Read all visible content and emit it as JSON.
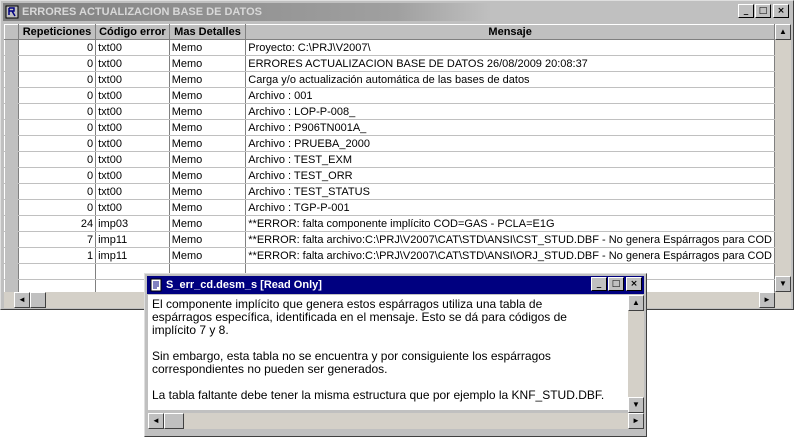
{
  "main_window": {
    "title": "ERRORES ACTUALIZACION BASE DE DATOS",
    "controls": {
      "minimize": "_",
      "maximize": "□",
      "close": "×"
    }
  },
  "grid": {
    "columns": [
      "Repeticiones",
      "Código error",
      "Mas Detalles",
      "Mensaje"
    ],
    "rows": [
      {
        "rep": "0",
        "code": "txt00",
        "detail": "Memo",
        "msg": "Proyecto: C:\\PRJ\\V2007\\"
      },
      {
        "rep": "0",
        "code": "txt00",
        "detail": "Memo",
        "msg": "ERRORES ACTUALIZACION BASE DE DATOS      26/08/2009      20:08:37"
      },
      {
        "rep": "0",
        "code": "txt00",
        "detail": "Memo",
        "msg": "Carga y/o actualización automática de las bases de datos"
      },
      {
        "rep": "0",
        "code": "txt00",
        "detail": "Memo",
        "msg": "Archivo : 001"
      },
      {
        "rep": "0",
        "code": "txt00",
        "detail": "Memo",
        "msg": "Archivo : LOP-P-008_"
      },
      {
        "rep": "0",
        "code": "txt00",
        "detail": "Memo",
        "msg": "Archivo : P906TN001A_"
      },
      {
        "rep": "0",
        "code": "txt00",
        "detail": "Memo",
        "msg": "Archivo : PRUEBA_2000"
      },
      {
        "rep": "0",
        "code": "txt00",
        "detail": "Memo",
        "msg": "Archivo : TEST_EXM"
      },
      {
        "rep": "0",
        "code": "txt00",
        "detail": "Memo",
        "msg": "Archivo : TEST_ORR"
      },
      {
        "rep": "0",
        "code": "txt00",
        "detail": "Memo",
        "msg": "Archivo : TEST_STATUS"
      },
      {
        "rep": "0",
        "code": "txt00",
        "detail": "Memo",
        "msg": "Archivo : TGP-P-001"
      },
      {
        "rep": "24",
        "code": "imp03",
        "detail": "Memo",
        "msg": "**ERROR: falta componente implícito COD=GAS    - PCLA=E1G"
      },
      {
        "rep": "7",
        "code": "imp11",
        "detail": "Memo",
        "msg": "**ERROR: falta archivo:C:\\PRJ\\V2007\\CAT\\STD\\ANSI\\CST_STUD.DBF - No genera Espárragos para COD"
      },
      {
        "rep": "1",
        "code": "imp11",
        "detail": "Memo",
        "msg": "**ERROR: falta archivo:C:\\PRJ\\V2007\\CAT\\STD\\ANSI\\ORJ_STUD.DBF - No genera Espárragos para COD"
      }
    ]
  },
  "memo_window": {
    "title": "S_err_cd.desm_s [Read Only]",
    "controls": {
      "minimize": "_",
      "maximize": "□",
      "close": "×"
    },
    "lines": [
      "El componente implícito que genera estos espárragos utiliza una tabla de",
      "espárragos específica, identificada en el mensaje. Esto se dá para códigos de",
      "implícito 7 y 8.",
      "",
      "Sin embargo, esta tabla no se encuentra y por consiguiente los espárragos",
      "correspondientes no pueden ser generados.",
      "",
      "La tabla faltante debe tener la misma estructura que por ejemplo la KNF_STUD.DBF."
    ]
  },
  "scroll_glyphs": {
    "up": "▲",
    "down": "▼",
    "left": "◄",
    "right": "►"
  },
  "colors": {
    "active_title": "#000080",
    "inactive_title": "#808080",
    "face": "#c0c0c0"
  }
}
